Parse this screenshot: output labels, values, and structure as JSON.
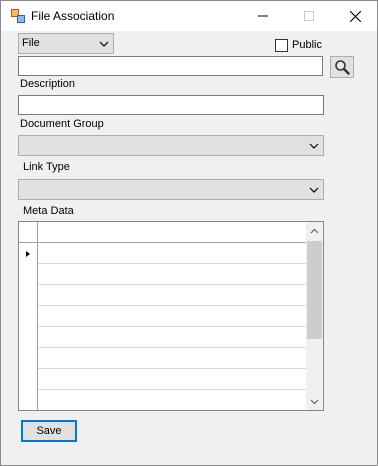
{
  "window": {
    "title": "File Association",
    "icon": "app-icon",
    "controls": {
      "minimize_icon": "minimize-icon",
      "maximize_icon": "maximize-icon",
      "close_icon": "close-icon"
    }
  },
  "form": {
    "type_select": {
      "value": "File"
    },
    "public_checkbox": {
      "label": "Public",
      "checked": false
    },
    "file_path_input": {
      "value": ""
    },
    "search_button": {
      "icon": "magnifier-icon"
    },
    "description": {
      "label": "Description",
      "value": ""
    },
    "document_group": {
      "label": "Document Group",
      "value": ""
    },
    "link_type": {
      "label": "Link Type",
      "value": ""
    },
    "meta_data": {
      "label": "Meta Data"
    }
  },
  "grid": {
    "row_count": 8,
    "current_row_indicator": "row-pointer-icon"
  },
  "actions": {
    "save_label": "Save"
  },
  "colors": {
    "window_bg": "#f0f0f0",
    "titlebar_bg": "#ffffff",
    "combo_bg": "#e1e1e1",
    "focus_border": "#0078d7"
  }
}
